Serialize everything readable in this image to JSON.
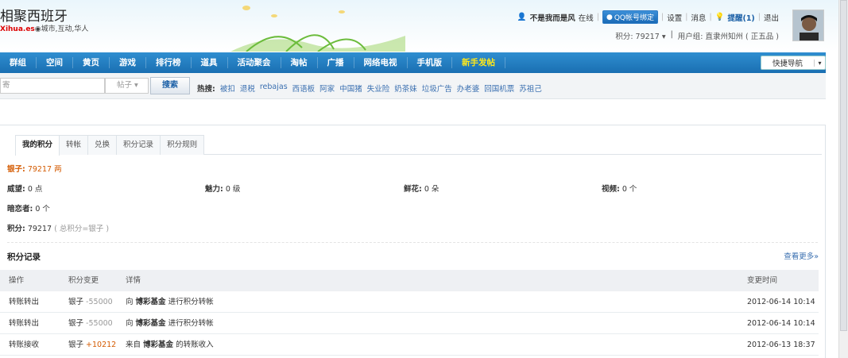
{
  "header": {
    "site_title": "相聚西班牙",
    "site_domain": "Xihua.es",
    "site_tagline": "城市,互动,华人",
    "user": {
      "name": "不是我而是风",
      "status": "在线",
      "qq_bind": "QQ帐号绑定",
      "settings": "设置",
      "messages": "消息",
      "reminder": "提醒(1)",
      "logout": "退出",
      "points": "积分: 79217",
      "user_group": "用户组: 直隶州知州 ( 正五品 )"
    }
  },
  "nav": {
    "items": [
      "群组",
      "空间",
      "黄页",
      "游戏",
      "排行榜",
      "道具",
      "活动聚会",
      "淘帖",
      "广播",
      "网络电视",
      "手机版",
      "新手发帖"
    ],
    "quick_nav": "快捷导航"
  },
  "search": {
    "placeholder": "寄",
    "type": "帖子",
    "button": "搜索",
    "hot_label": "热搜:",
    "hot_keywords": [
      "被扣",
      "退税",
      "rebajas",
      "西语板",
      "阿家",
      "中国猪",
      "失业险",
      "奶茶妹",
      "垃圾广告",
      "办老婆",
      "回国机票",
      "苏祖己"
    ]
  },
  "tabs": [
    "我的积分",
    "转帐",
    "兑换",
    "积分记录",
    "积分规则"
  ],
  "credits": {
    "silver_label": "银子:",
    "silver_value": "79217 两",
    "prestige_label": "威望:",
    "prestige_value": "0 点",
    "charm_label": "魅力:",
    "charm_value": "0 级",
    "flowers_label": "鲜花:",
    "flowers_value": "0 朵",
    "video_label": "视频:",
    "video_value": "0 个",
    "admirers_label": "暗恋者:",
    "admirers_value": "0 个",
    "points_label": "积分:",
    "points_value": "79217",
    "points_formula": "( 总积分=银子 )"
  },
  "records": {
    "title": "积分记录",
    "view_more": "查看更多»",
    "columns": [
      "操作",
      "积分变更",
      "详情",
      "变更时间"
    ],
    "rows": [
      {
        "action": "转账转出",
        "currency": "银子",
        "change": "-55000",
        "prefix": "向",
        "target": "博彩基金",
        "suffix": "进行积分转帐",
        "time": "2012-06-14 10:14"
      },
      {
        "action": "转账转出",
        "currency": "银子",
        "change": "-55000",
        "prefix": "向",
        "target": "博彩基金",
        "suffix": "进行积分转帐",
        "time": "2012-06-14 10:14"
      },
      {
        "action": "转账接收",
        "currency": "银子",
        "change": "+10212",
        "prefix": "来自",
        "target": "博彩基金",
        "suffix": "的转账收入",
        "time": "2012-06-13 18:37"
      }
    ]
  },
  "colors": {
    "nav_blue": "#1a6fb2",
    "accent_orange": "#d45a00",
    "link_blue": "#3a6fb0"
  }
}
